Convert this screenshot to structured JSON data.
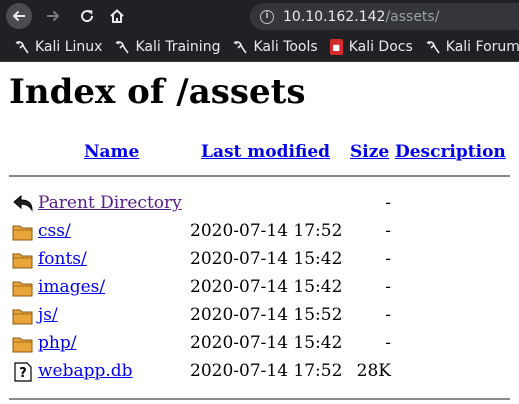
{
  "browser": {
    "url_host": "10.10.162.142",
    "url_path": "/assets/",
    "bookmarks": [
      {
        "label": "Kali Linux",
        "icon": "kali-dragon-icon"
      },
      {
        "label": "Kali Training",
        "icon": "kali-dragon-icon"
      },
      {
        "label": "Kali Tools",
        "icon": "kali-dragon-icon"
      },
      {
        "label": "Kali Docs",
        "icon": "kali-docs-icon"
      },
      {
        "label": "Kali Forums",
        "icon": "kali-dragon-icon"
      }
    ]
  },
  "page": {
    "title": "Index of /assets",
    "columns": {
      "name": "Name",
      "last_modified": "Last modified",
      "size": "Size",
      "description": "Description"
    },
    "rows": [
      {
        "name": "Parent Directory",
        "date": "",
        "size": "-",
        "icon": "parent-directory-icon"
      },
      {
        "name": "css/",
        "date": "2020-07-14 17:52",
        "size": "-",
        "icon": "folder-icon"
      },
      {
        "name": "fonts/",
        "date": "2020-07-14 15:42",
        "size": "-",
        "icon": "folder-icon"
      },
      {
        "name": "images/",
        "date": "2020-07-14 15:42",
        "size": "-",
        "icon": "folder-icon"
      },
      {
        "name": "js/",
        "date": "2020-07-14 15:52",
        "size": "-",
        "icon": "folder-icon"
      },
      {
        "name": "php/",
        "date": "2020-07-14 15:42",
        "size": "-",
        "icon": "folder-icon"
      },
      {
        "name": "webapp.db",
        "date": "2020-07-14 17:52",
        "size": "28K",
        "icon": "unknown-file-icon"
      }
    ]
  }
}
